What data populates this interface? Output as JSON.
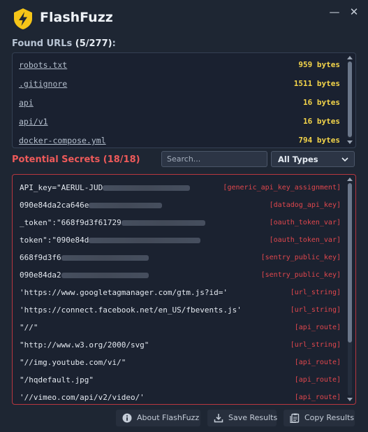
{
  "app": {
    "title": "FlashFuzz"
  },
  "window": {
    "minimize_glyph": "—",
    "close_glyph": "✕"
  },
  "found_urls": {
    "title": "Found URLs",
    "count": "(5/277)",
    "suffix": ":",
    "items": [
      {
        "url": "robots.txt",
        "size": "959 bytes"
      },
      {
        "url": ".gitignore",
        "size": "1511 bytes"
      },
      {
        "url": "api",
        "size": "16 bytes"
      },
      {
        "url": "api/v1",
        "size": "16 bytes"
      },
      {
        "url": "docker-compose.yml",
        "size": "794 bytes"
      }
    ]
  },
  "secrets": {
    "title": "Potential Secrets (18/18)",
    "search_placeholder": "Search...",
    "filter_selected": "All Types",
    "items": [
      {
        "value": "API_key=\"AERUL-JUD",
        "redacted": true,
        "type": "[generic_api_key_assignment]"
      },
      {
        "value": "090e84da2ca646e",
        "redacted": true,
        "type": "[datadog_api_key]"
      },
      {
        "value": "_token\":\"668f9d3f61729",
        "redacted": true,
        "type": "[oauth_token_var]"
      },
      {
        "value": "token\":\"090e84d",
        "redacted": true,
        "type": "[oauth_token_var]"
      },
      {
        "value": "668f9d3f6",
        "redacted": true,
        "type": "[sentry_public_key]"
      },
      {
        "value": "090e84da2",
        "redacted": true,
        "type": "[sentry_public_key]"
      },
      {
        "value": "'https://www.googletagmanager.com/gtm.js?id='",
        "redacted": false,
        "type": "[url_string]"
      },
      {
        "value": "'https://connect.facebook.net/en_US/fbevents.js'",
        "redacted": false,
        "type": "[url_string]"
      },
      {
        "value": "\"//\"",
        "redacted": false,
        "type": "[api_route]"
      },
      {
        "value": "\"http://www.w3.org/2000/svg\"",
        "redacted": false,
        "type": "[url_string]"
      },
      {
        "value": "\"//img.youtube.com/vi/\"",
        "redacted": false,
        "type": "[api_route]"
      },
      {
        "value": "\"/hqdefault.jpg\"",
        "redacted": false,
        "type": "[api_route]"
      },
      {
        "value": "'//vimeo.com/api/v2/video/'",
        "redacted": false,
        "type": "[api_route]"
      }
    ]
  },
  "footer": {
    "about_label": "About FlashFuzz",
    "save_label": "Save Results",
    "copy_label": "Copy Results"
  },
  "icons": {
    "logo": "lightning-shield-icon",
    "about": "info-icon",
    "save": "download-icon",
    "copy": "clipboard-icon"
  },
  "colors": {
    "background": "#1e2633",
    "accent_yellow": "#f5c518",
    "secret_red": "#e0474d",
    "size_yellow": "#f5d64a"
  }
}
